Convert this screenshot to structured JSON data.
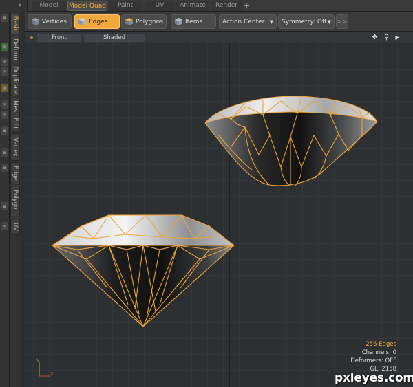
{
  "mode_tabs": [
    "Model",
    "Model Quad",
    "Paint",
    "UV",
    "Animate",
    "Render"
  ],
  "mode_tabs_active": "Model Quad",
  "mode_tabs_plus": "+",
  "toolbar": {
    "vertices_label": "Vertices",
    "edges_label": "Edges",
    "polygons_label": "Polygons",
    "items_label": "Items",
    "action_center_label": "Action Center",
    "symmetry_label": "Symmetry: Off",
    "more_label": ">>"
  },
  "vertical_tabs": [
    "Basic",
    "Deform",
    "Duplicate",
    "Mesh Edit",
    "Vertex",
    "Edge",
    "Polygon",
    "UV"
  ],
  "vertical_tabs_active": "Basic",
  "viewport": {
    "view_label": "Front",
    "shading_label": "Shaded"
  },
  "stats": {
    "edges": "256 Edges",
    "channels": "Channels: 0",
    "deformers": "Deformers: OFF",
    "gl": "GL: 2158"
  },
  "axis": {
    "y_label": "Y",
    "x_label": "X"
  },
  "watermark": "pxleyes.com",
  "colors": {
    "accent": "#f3a83b",
    "wireframe": "#f2a335",
    "viewport_bg": "#2d3033",
    "grid": "#3a3e42"
  },
  "icons": {
    "move_icon": "four-arrows",
    "zoom_icon": "magnifier",
    "menu_arrow_icon": "triangle-right"
  }
}
